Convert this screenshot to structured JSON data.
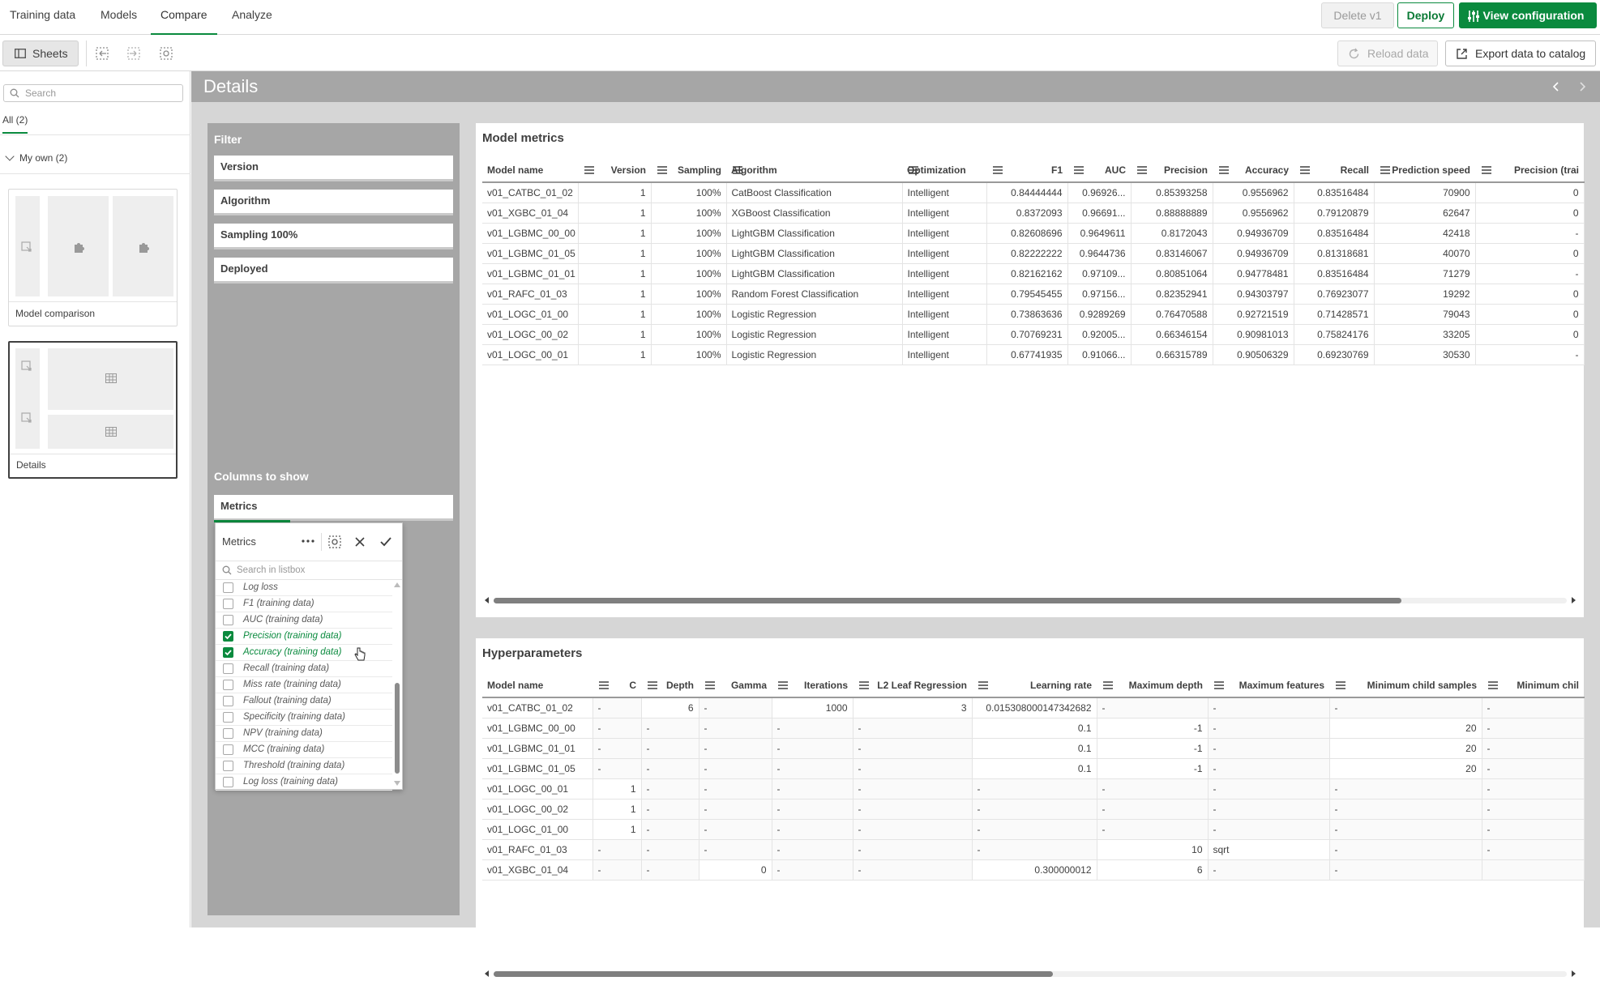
{
  "nav": {
    "tabs": [
      "Training data",
      "Models",
      "Compare",
      "Analyze"
    ],
    "active_tab": "Compare",
    "delete_label": "Delete v1",
    "deploy_label": "Deploy",
    "view_config_label": "View configuration"
  },
  "toolbar": {
    "sheets_label": "Sheets",
    "reload_label": "Reload data",
    "export_label": "Export data to catalog"
  },
  "sidebar": {
    "search_placeholder": "Search",
    "tab_all": "All (2)",
    "group_label": "My own (2)",
    "sheets": [
      {
        "label": "Model comparison"
      },
      {
        "label": "Details"
      }
    ]
  },
  "main": {
    "title": "Details"
  },
  "filter": {
    "title": "Filter",
    "bars": [
      "Version",
      "Algorithm",
      "Sampling 100%",
      "Deployed"
    ],
    "columns_title": "Columns to show",
    "columns_bar": "Metrics"
  },
  "listbox": {
    "title": "Metrics",
    "search_placeholder": "Search in listbox",
    "items": [
      {
        "label": "Log loss",
        "selected": false
      },
      {
        "label": "F1 (training data)",
        "selected": false
      },
      {
        "label": "AUC (training data)",
        "selected": false
      },
      {
        "label": "Precision (training data)",
        "selected": true
      },
      {
        "label": "Accuracy (training data)",
        "selected": true
      },
      {
        "label": "Recall (training data)",
        "selected": false
      },
      {
        "label": "Miss rate (training data)",
        "selected": false
      },
      {
        "label": "Fallout (training data)",
        "selected": false
      },
      {
        "label": "Specificity (training data)",
        "selected": false
      },
      {
        "label": "NPV (training data)",
        "selected": false
      },
      {
        "label": "MCC (training data)",
        "selected": false
      },
      {
        "label": "Threshold (training data)",
        "selected": false
      },
      {
        "label": "Log loss (training data)",
        "selected": false
      }
    ]
  },
  "metrics_table": {
    "title": "Model metrics",
    "columns": [
      "Model name",
      "Version",
      "Sampling",
      "Algorithm",
      "Optimization",
      "F1",
      "AUC",
      "Precision",
      "Accuracy",
      "Recall",
      "Prediction speed",
      "Precision (trai"
    ],
    "rows": [
      [
        "v01_CATBC_01_02",
        "1",
        "100%",
        "CatBoost Classification",
        "Intelligent",
        "0.84444444",
        "0.96926...",
        "0.85393258",
        "0.9556962",
        "0.83516484",
        "70900",
        "0"
      ],
      [
        "v01_XGBC_01_04",
        "1",
        "100%",
        "XGBoost Classification",
        "Intelligent",
        "0.8372093",
        "0.96691...",
        "0.88888889",
        "0.9556962",
        "0.79120879",
        "62647",
        "0"
      ],
      [
        "v01_LGBMC_00_00",
        "1",
        "100%",
        "LightGBM Classification",
        "Intelligent",
        "0.82608696",
        "0.9649611",
        "0.8172043",
        "0.94936709",
        "0.83516484",
        "42418",
        "-"
      ],
      [
        "v01_LGBMC_01_05",
        "1",
        "100%",
        "LightGBM Classification",
        "Intelligent",
        "0.82222222",
        "0.9644736",
        "0.83146067",
        "0.94936709",
        "0.81318681",
        "40070",
        "0"
      ],
      [
        "v01_LGBMC_01_01",
        "1",
        "100%",
        "LightGBM Classification",
        "Intelligent",
        "0.82162162",
        "0.97109...",
        "0.80851064",
        "0.94778481",
        "0.83516484",
        "71279",
        "-"
      ],
      [
        "v01_RAFC_01_03",
        "1",
        "100%",
        "Random Forest Classification",
        "Intelligent",
        "0.79545455",
        "0.97156...",
        "0.82352941",
        "0.94303797",
        "0.76923077",
        "19292",
        "0"
      ],
      [
        "v01_LOGC_01_00",
        "1",
        "100%",
        "Logistic Regression",
        "Intelligent",
        "0.73863636",
        "0.9289269",
        "0.76470588",
        "0.92721519",
        "0.71428571",
        "79043",
        "0"
      ],
      [
        "v01_LOGC_00_02",
        "1",
        "100%",
        "Logistic Regression",
        "Intelligent",
        "0.70769231",
        "0.92005...",
        "0.66346154",
        "0.90981013",
        "0.75824176",
        "33205",
        "0"
      ],
      [
        "v01_LOGC_00_01",
        "1",
        "100%",
        "Logistic Regression",
        "Intelligent",
        "0.67741935",
        "0.91066...",
        "0.66315789",
        "0.90506329",
        "0.69230769",
        "30530",
        "-"
      ]
    ]
  },
  "hyper_table": {
    "title": "Hyperparameters",
    "columns": [
      "Model name",
      "C",
      "Depth",
      "Gamma",
      "Iterations",
      "L2 Leaf Regression",
      "Learning rate",
      "Maximum depth",
      "Maximum features",
      "Minimum child samples",
      "Minimum chil"
    ],
    "rows": [
      [
        "v01_CATBC_01_02",
        "-",
        "6",
        "-",
        "1000",
        "3",
        "0.015308000147342682",
        "-",
        "-",
        "-",
        "-"
      ],
      [
        "v01_LGBMC_00_00",
        "-",
        "-",
        "-",
        "-",
        "-",
        "0.1",
        "-1",
        "-",
        "20",
        "-"
      ],
      [
        "v01_LGBMC_01_01",
        "-",
        "-",
        "-",
        "-",
        "-",
        "0.1",
        "-1",
        "-",
        "20",
        "-"
      ],
      [
        "v01_LGBMC_01_05",
        "-",
        "-",
        "-",
        "-",
        "-",
        "0.1",
        "-1",
        "-",
        "20",
        "-"
      ],
      [
        "v01_LOGC_00_01",
        "1",
        "-",
        "-",
        "-",
        "-",
        "-",
        "-",
        "-",
        "-",
        "-"
      ],
      [
        "v01_LOGC_00_02",
        "1",
        "-",
        "-",
        "-",
        "-",
        "-",
        "-",
        "-",
        "-",
        "-"
      ],
      [
        "v01_LOGC_01_00",
        "1",
        "-",
        "-",
        "-",
        "-",
        "-",
        "-",
        "-",
        "-",
        "-"
      ],
      [
        "v01_RAFC_01_03",
        "-",
        "-",
        "-",
        "-",
        "-",
        "-",
        "10",
        "sqrt",
        "-",
        "-"
      ],
      [
        "v01_XGBC_01_04",
        "-",
        "-",
        "0",
        "-",
        "-",
        "0.300000012",
        "6",
        "-",
        "-",
        ""
      ]
    ]
  },
  "colors": {
    "accent": "#0a8a3e",
    "panel_gray": "#a6a6a6",
    "canvas": "#d6d6d6"
  }
}
